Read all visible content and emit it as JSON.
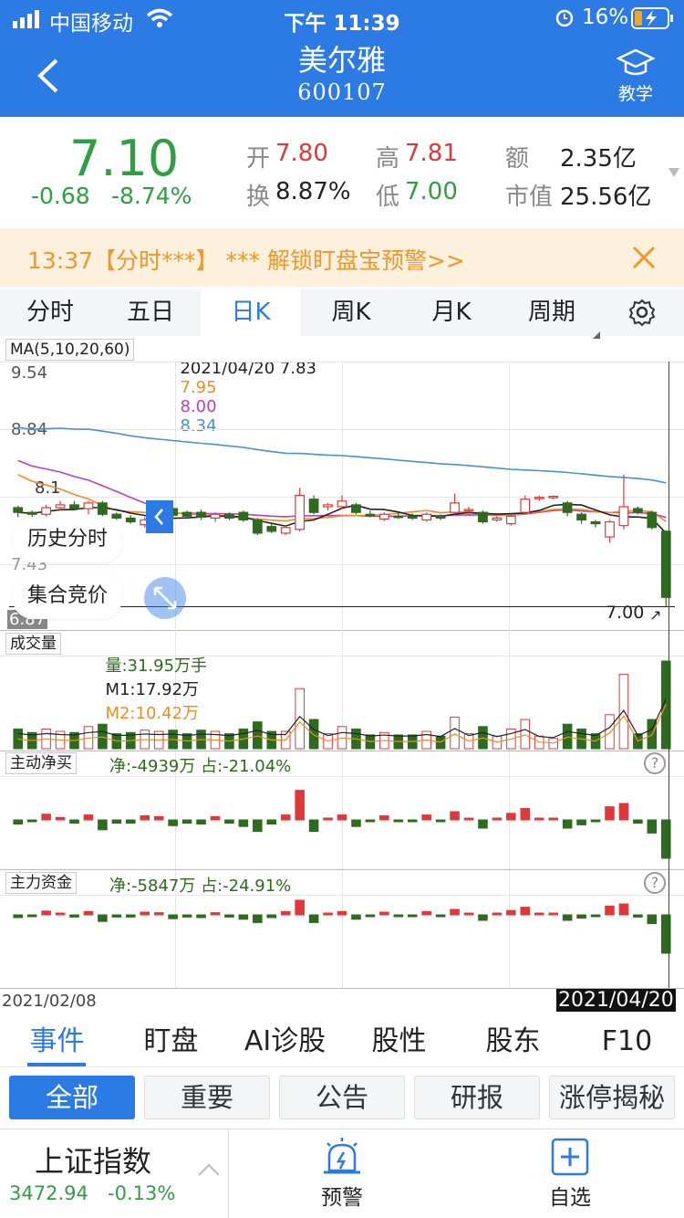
{
  "status": {
    "carrier": "中国移动",
    "time": "下午 11:39",
    "battery": "16%"
  },
  "header": {
    "name": "美尔雅",
    "code": "600107",
    "teach_label": "教学"
  },
  "quote": {
    "price": "7.10",
    "change": "-0.68",
    "change_pct": "-8.74%",
    "open_label": "开",
    "open": "7.80",
    "high_label": "高",
    "high": "7.81",
    "amount_label": "额",
    "amount": "2.35亿",
    "turnover_label": "换",
    "turnover": "8.87%",
    "low_label": "低",
    "low": "7.00",
    "mktcap_label": "市值",
    "mktcap": "25.56亿"
  },
  "banner": {
    "text": "13:37【分时***】 *** 解锁盯盘宝预警>>"
  },
  "chart_tabs": [
    "分时",
    "五日",
    "日K",
    "周K",
    "月K",
    "周期"
  ],
  "ma": {
    "label": "MA(5,10,20,60)",
    "date_price": "2021/04/20 7.83",
    "v1": "7.95",
    "v2": "8.00",
    "v3": "8.34"
  },
  "y_axis": {
    "top": "9.54",
    "t2": "8.84",
    "t3": "8.1",
    "t4": "7.43",
    "bottom": "6.87",
    "last": "7.00"
  },
  "floating": {
    "history": "历史分时",
    "auction": "集合竞价"
  },
  "volume": {
    "label": "成交量",
    "vol": "量:31.95万手",
    "m1": "M1:17.92万",
    "m2": "M2:10.42万"
  },
  "net_buy": {
    "label": "主动净买",
    "text": "净:-4939万 占:-21.04%"
  },
  "main_fund": {
    "label": "主力资金",
    "text": "净:-5847万 占:-24.91%"
  },
  "dates": {
    "start": "2021/02/08",
    "end": "2021/04/20"
  },
  "event_tabs": [
    "事件",
    "盯盘",
    "AI诊股",
    "股性",
    "股东",
    "F10"
  ],
  "filters": [
    "全部",
    "重要",
    "公告",
    "研报",
    "涨停揭秘"
  ],
  "bottom": {
    "index_name": "上证指数",
    "index_value": "3472.94",
    "index_change": "-0.13%",
    "alert_label": "预警",
    "watch_label": "自选"
  },
  "colors": {
    "brand": "#2c7be5",
    "up": "#e0383a",
    "down": "#2f6b1e",
    "ma5": "#222222",
    "ma10": "#f08c28",
    "ma20": "#c03fb4",
    "ma60": "#4a8fd6"
  },
  "chart_data": {
    "type": "candlestick",
    "ylim": [
      6.87,
      9.54
    ],
    "candles": [
      {
        "o": 8.05,
        "h": 8.07,
        "l": 7.95,
        "c": 8.0
      },
      {
        "o": 8.0,
        "h": 8.02,
        "l": 7.93,
        "c": 7.98
      },
      {
        "o": 7.98,
        "h": 8.08,
        "l": 7.96,
        "c": 8.05
      },
      {
        "o": 8.05,
        "h": 8.12,
        "l": 8.02,
        "c": 8.08
      },
      {
        "o": 8.08,
        "h": 8.12,
        "l": 8.03,
        "c": 8.04
      },
      {
        "o": 8.04,
        "h": 8.12,
        "l": 7.98,
        "c": 8.1
      },
      {
        "o": 8.1,
        "h": 8.12,
        "l": 7.96,
        "c": 7.98
      },
      {
        "o": 7.98,
        "h": 8.0,
        "l": 7.92,
        "c": 7.94
      },
      {
        "o": 7.94,
        "h": 7.97,
        "l": 7.88,
        "c": 7.9
      },
      {
        "o": 7.87,
        "h": 7.95,
        "l": 7.84,
        "c": 7.92
      },
      {
        "o": 7.92,
        "h": 7.98,
        "l": 7.88,
        "c": 7.96
      },
      {
        "o": 8.04,
        "h": 8.06,
        "l": 7.95,
        "c": 7.97
      },
      {
        "o": 8.0,
        "h": 8.02,
        "l": 7.94,
        "c": 7.96
      },
      {
        "o": 8.0,
        "h": 8.03,
        "l": 7.92,
        "c": 7.95
      },
      {
        "o": 7.94,
        "h": 8.0,
        "l": 7.9,
        "c": 7.98
      },
      {
        "o": 7.98,
        "h": 8.0,
        "l": 7.92,
        "c": 7.94
      },
      {
        "o": 8.0,
        "h": 8.02,
        "l": 7.9,
        "c": 7.92
      },
      {
        "o": 7.92,
        "h": 7.94,
        "l": 7.76,
        "c": 7.78
      },
      {
        "o": 7.85,
        "h": 7.88,
        "l": 7.78,
        "c": 7.8
      },
      {
        "o": 7.78,
        "h": 7.86,
        "l": 7.76,
        "c": 7.84
      },
      {
        "o": 7.82,
        "h": 8.26,
        "l": 7.8,
        "c": 8.18
      },
      {
        "o": 8.14,
        "h": 8.18,
        "l": 7.98,
        "c": 8.0
      },
      {
        "o": 8.06,
        "h": 8.1,
        "l": 8.02,
        "c": 8.08
      },
      {
        "o": 8.06,
        "h": 8.18,
        "l": 8.04,
        "c": 8.12
      },
      {
        "o": 8.08,
        "h": 8.1,
        "l": 7.98,
        "c": 8.0
      },
      {
        "o": 7.98,
        "h": 8.02,
        "l": 7.95,
        "c": 7.97
      },
      {
        "o": 7.93,
        "h": 8.0,
        "l": 7.91,
        "c": 7.98
      },
      {
        "o": 7.96,
        "h": 8.0,
        "l": 7.93,
        "c": 7.95
      },
      {
        "o": 7.96,
        "h": 7.99,
        "l": 7.92,
        "c": 7.94
      },
      {
        "o": 7.92,
        "h": 8.0,
        "l": 7.9,
        "c": 7.98
      },
      {
        "o": 7.96,
        "h": 7.98,
        "l": 7.92,
        "c": 7.94
      },
      {
        "o": 8.0,
        "h": 8.2,
        "l": 7.98,
        "c": 8.1
      },
      {
        "o": 8.02,
        "h": 8.06,
        "l": 7.98,
        "c": 8.03
      },
      {
        "o": 8.0,
        "h": 8.02,
        "l": 7.88,
        "c": 7.9
      },
      {
        "o": 7.92,
        "h": 7.96,
        "l": 7.9,
        "c": 7.94
      },
      {
        "o": 7.88,
        "h": 7.98,
        "l": 7.86,
        "c": 7.96
      },
      {
        "o": 8.0,
        "h": 8.18,
        "l": 7.98,
        "c": 8.14
      },
      {
        "o": 8.16,
        "h": 8.18,
        "l": 8.12,
        "c": 8.16
      },
      {
        "o": 8.16,
        "h": 8.18,
        "l": 8.14,
        "c": 8.17
      },
      {
        "o": 8.1,
        "h": 8.12,
        "l": 7.96,
        "c": 8.0
      },
      {
        "o": 7.98,
        "h": 8.0,
        "l": 7.88,
        "c": 7.92
      },
      {
        "o": 7.9,
        "h": 7.92,
        "l": 7.84,
        "c": 7.88
      },
      {
        "o": 7.74,
        "h": 7.92,
        "l": 7.68,
        "c": 7.9
      },
      {
        "o": 7.86,
        "h": 8.4,
        "l": 7.82,
        "c": 8.06
      },
      {
        "o": 8.04,
        "h": 8.06,
        "l": 7.98,
        "c": 8.0
      },
      {
        "o": 8.0,
        "h": 8.02,
        "l": 7.82,
        "c": 7.84
      },
      {
        "o": 7.8,
        "h": 7.81,
        "l": 7.0,
        "c": 7.1
      }
    ]
  }
}
